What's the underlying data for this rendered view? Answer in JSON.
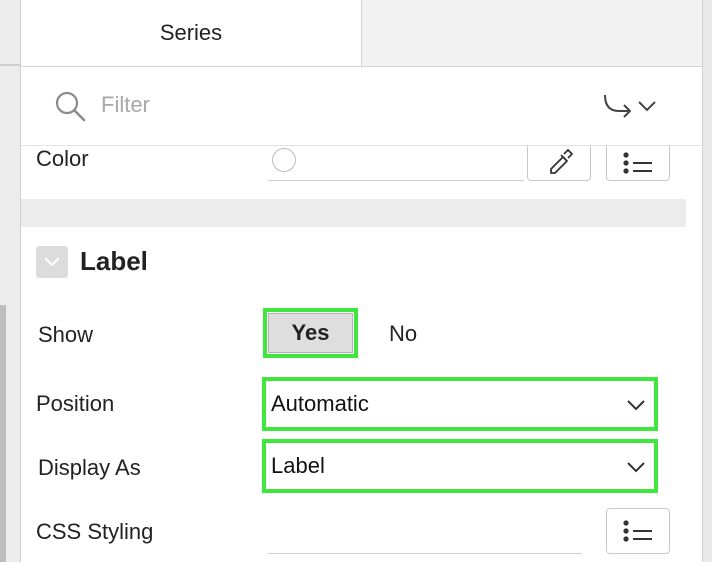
{
  "tabs": [
    {
      "label": "Series",
      "active": true
    },
    {
      "label": "",
      "active": false
    }
  ],
  "filter": {
    "placeholder": "Filter",
    "value": ""
  },
  "color_row": {
    "label": "Color"
  },
  "section": {
    "title": "Label",
    "expanded": true
  },
  "rows": {
    "show": {
      "label": "Show",
      "options": [
        "Yes",
        "No"
      ],
      "selected": "Yes"
    },
    "position": {
      "label": "Position",
      "value": "Automatic"
    },
    "display_as": {
      "label": "Display As",
      "value": "Label"
    },
    "css_styling": {
      "label": "CSS Styling",
      "value": ""
    }
  },
  "colors": {
    "highlight": "#3ee63e",
    "text": "#222222",
    "muted": "#a8a8a8"
  },
  "icons": [
    "search-icon",
    "go-to-group-icon",
    "chevron-down-icon",
    "eyedropper-icon",
    "list-icon",
    "collapse-icon"
  ]
}
